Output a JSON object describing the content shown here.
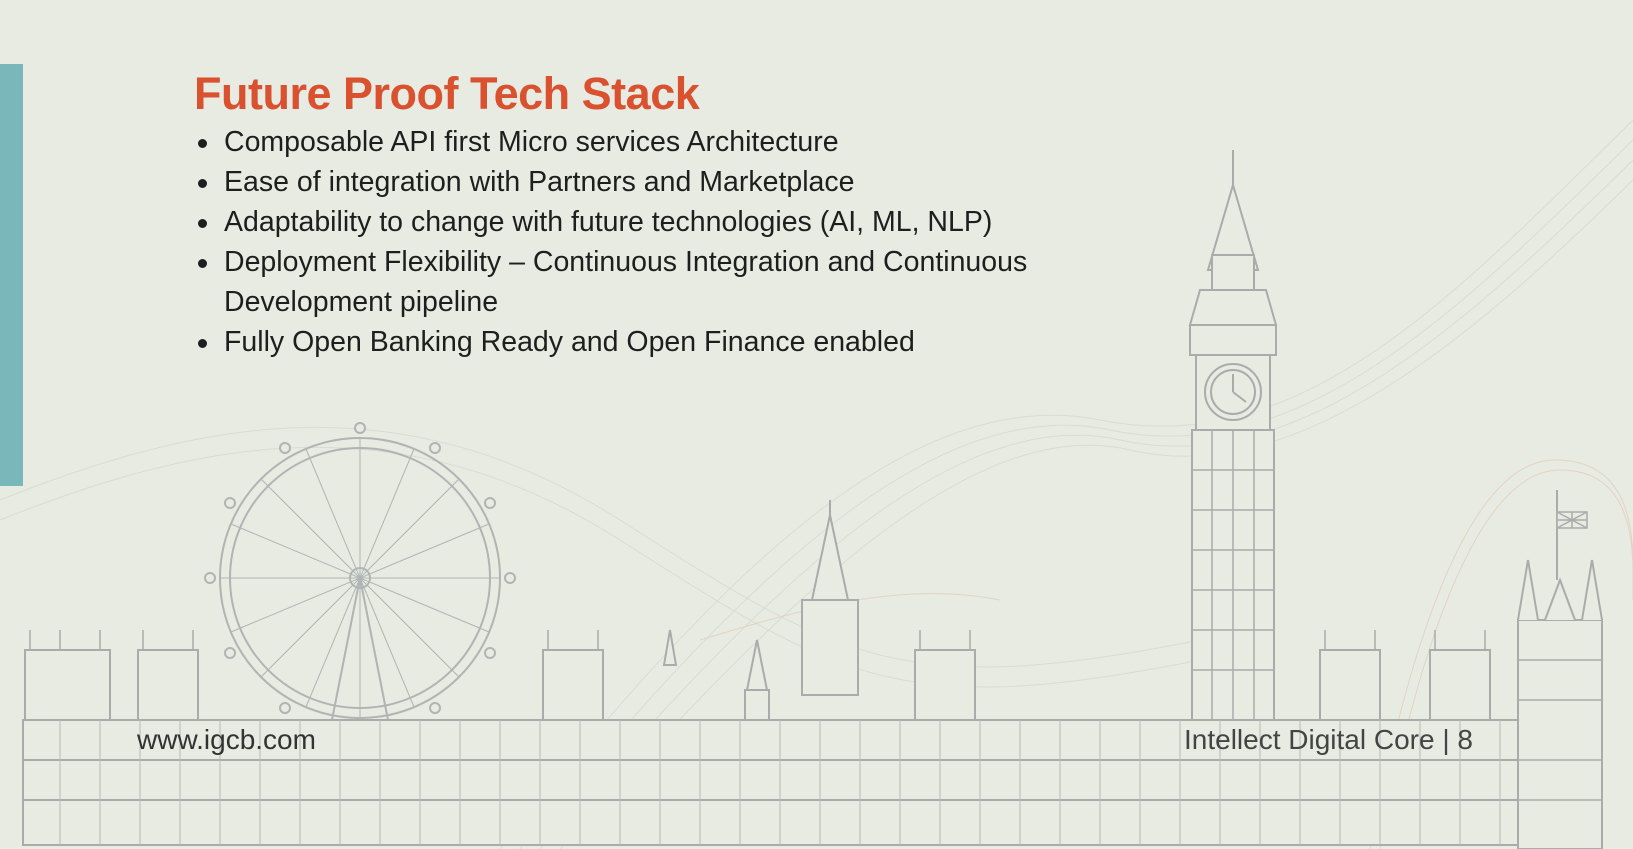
{
  "slide": {
    "title": "Future Proof Tech Stack",
    "bullets": [
      "Composable API first Micro services Architecture",
      "Ease of integration with Partners and Marketplace",
      "Adaptability to change with future technologies (AI, ML, NLP)",
      "Deployment Flexibility – Continuous Integration and Continuous Development pipeline",
      "Fully Open Banking Ready and Open Finance enabled"
    ]
  },
  "footer": {
    "website": "www.igcb.com",
    "page_label": "Intellect Digital Core | 8"
  },
  "colors": {
    "background": "#e7ebe2",
    "title": "#d9512f",
    "accent_bar": "#78b8bb",
    "skyline": "#a8acab"
  },
  "icons": [
    "london-eye-icon",
    "big-ben-icon",
    "parliament-skyline-icon",
    "union-flag-icon"
  ]
}
